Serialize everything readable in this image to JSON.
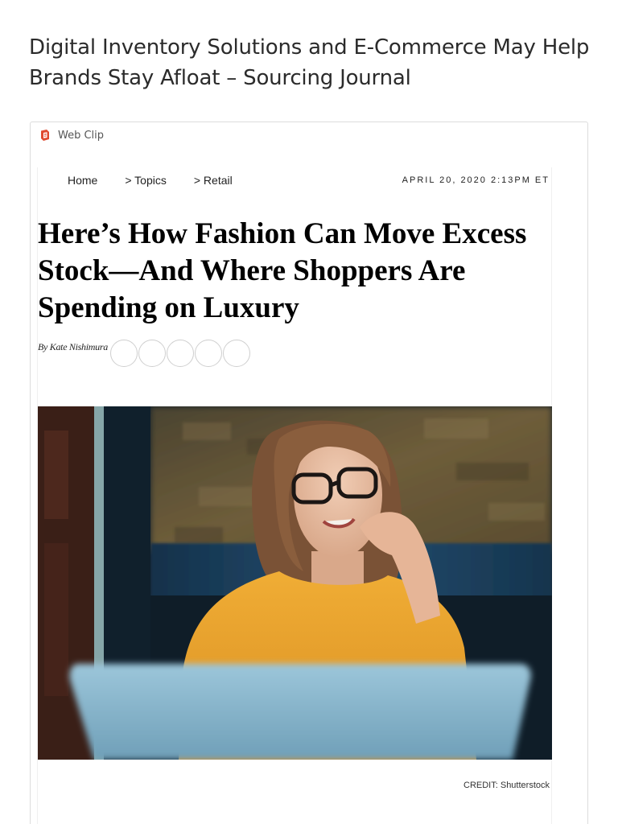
{
  "page": {
    "title": "Digital Inventory Solutions and E-Commerce May Help Brands Stay Afloat – Sourcing Journal"
  },
  "clip": {
    "label": "Web Clip",
    "icon": "web-clip-icon",
    "icon_color": "#e04a2f"
  },
  "article": {
    "breadcrumbs": [
      "Home",
      "> Topics",
      "> Retail"
    ],
    "date": "APRIL 20, 2020 2:13PM ET",
    "headline": "Here’s How Fashion Can Move Excess Stock—And Where Shoppers Are Spending on Luxury",
    "byline": "By Kate Nishimura",
    "share_buttons": 5,
    "image": {
      "description_icon": "woman-with-laptop-photo"
    },
    "credit": "CREDIT: Shutterstock"
  },
  "colors": {
    "sweater": "#e8a12e",
    "brick": "#6b5a3a",
    "wall_band": "#1f4a6b",
    "laptop": "#8ab7cf"
  }
}
